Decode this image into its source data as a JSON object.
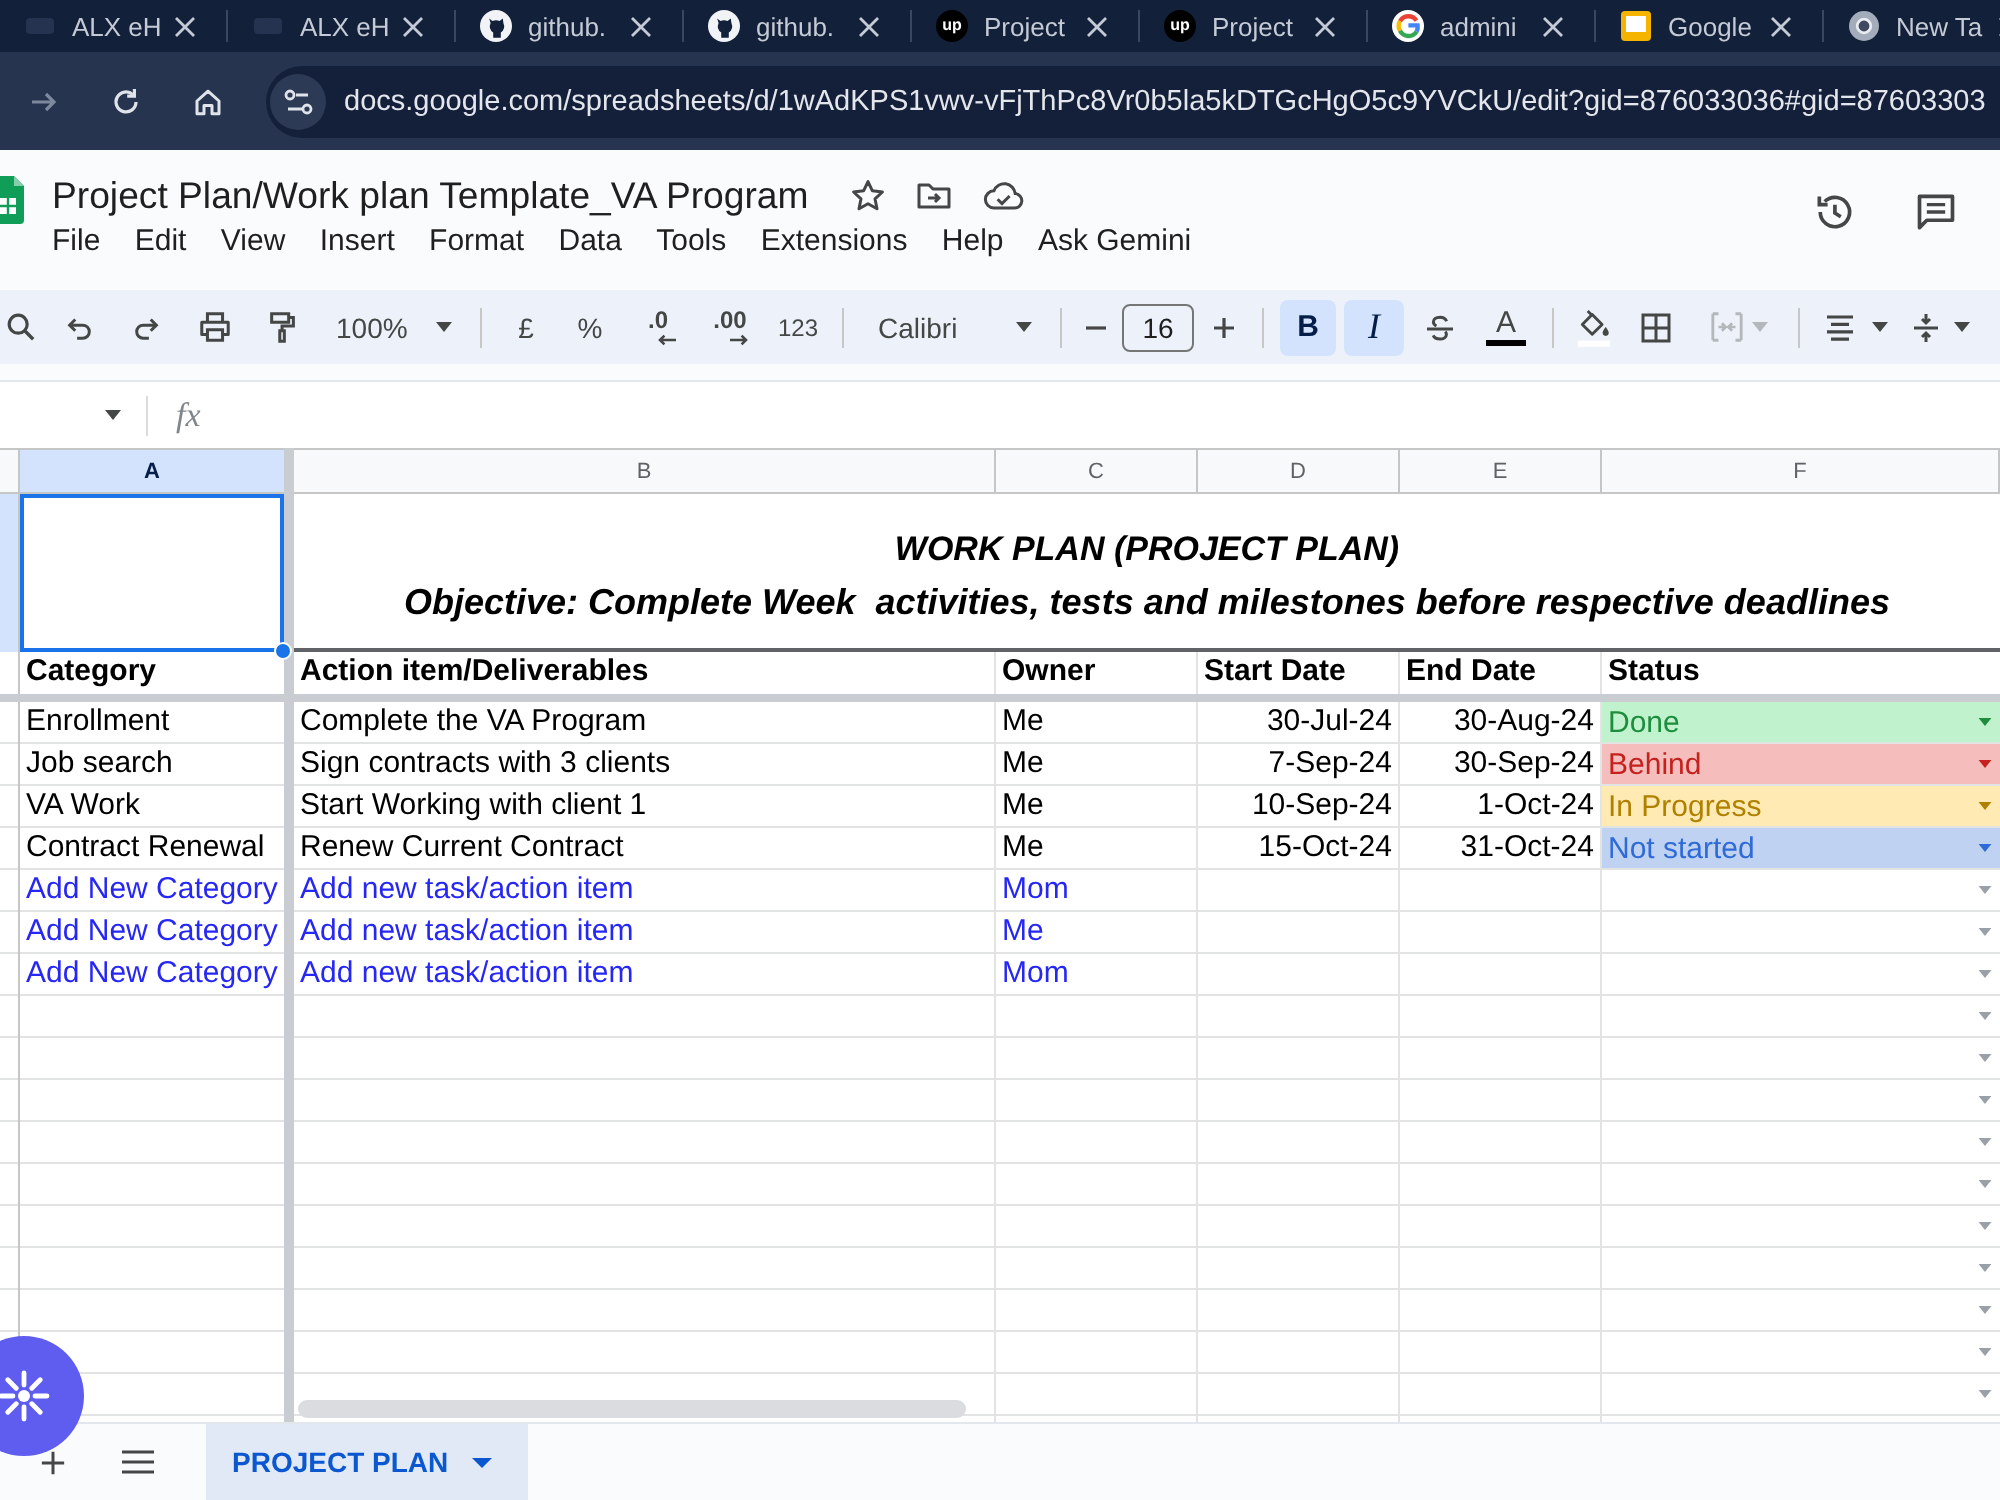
{
  "browser": {
    "tabs": [
      {
        "title": "ALX eH"
      },
      {
        "title": "ALX eH"
      },
      {
        "title": "github."
      },
      {
        "title": "github."
      },
      {
        "title": "Project",
        "badge": "up"
      },
      {
        "title": "Project",
        "badge": "up"
      },
      {
        "title": "admini"
      },
      {
        "title": "Google"
      },
      {
        "title": "New Ta"
      }
    ],
    "url": "docs.google.com/spreadsheets/d/1wAdKPS1vwv-vFjThPc8Vr0b5la5kDTGcHgO5c9YVCkU/edit?gid=876033036#gid=87603303"
  },
  "document": {
    "title": "Project Plan/Work plan Template_VA Program",
    "menu": [
      "File",
      "Edit",
      "View",
      "Insert",
      "Format",
      "Data",
      "Tools",
      "Extensions",
      "Help",
      "Ask Gemini"
    ]
  },
  "toolbar": {
    "zoom": "100%",
    "currency": "£",
    "percent": "%",
    "decrease_decimals": ".0",
    "increase_decimals": ".00",
    "number_format": "123",
    "font": "Calibri",
    "font_size": "16",
    "bold": {
      "label": "B",
      "on": true
    },
    "italic": {
      "label": "I",
      "on": true
    },
    "text_color": "A",
    "merge": {
      "disabled": true
    }
  },
  "formula_bar": {
    "label": "fx"
  },
  "sheet": {
    "columns": [
      {
        "label": "A",
        "selected": true
      },
      {
        "label": "B",
        "selected": false
      },
      {
        "label": "C",
        "selected": false
      },
      {
        "label": "D",
        "selected": false
      },
      {
        "label": "E",
        "selected": false
      },
      {
        "label": "F",
        "selected": false
      }
    ],
    "first_cell": {
      "selected": true
    },
    "title": "WORK PLAN (PROJECT PLAN)",
    "objective": "Objective: Complete Week  activities, tests and milestones before respective deadlines",
    "headers": [
      "Category",
      "Action item/Deliverables",
      "Owner",
      "Start Date",
      "End Date",
      "Status"
    ],
    "rows": [
      {
        "kind": "task",
        "category": "Enrollment",
        "action": "Complete the VA Program",
        "owner": "Me",
        "start": "30-Jul-24",
        "end": "30-Aug-24",
        "status": {
          "text": "Done",
          "color": "#1e8e3e"
        }
      },
      {
        "kind": "task",
        "category": "Job search",
        "action": "Sign contracts with 3 clients",
        "owner": "Me",
        "start": "7-Sep-24",
        "end": "30-Sep-24",
        "status": {
          "text": "Behind",
          "color": "#c5221f"
        }
      },
      {
        "kind": "task",
        "category": "VA Work",
        "action": "Start Working with client 1",
        "owner": "Me",
        "start": "10-Sep-24",
        "end": "1-Oct-24",
        "status": {
          "text": "In Progress",
          "color": "#b08000"
        }
      },
      {
        "kind": "task",
        "category": "Contract Renewal",
        "action": "Renew Current Contract",
        "owner": "Me",
        "start": "15-Oct-24",
        "end": "31-Oct-24",
        "status": {
          "text": "Not started",
          "color": "#2f6bd6"
        }
      },
      {
        "kind": "template",
        "category": "Add New Category",
        "action": "Add new task/action item",
        "owner": "Mom"
      },
      {
        "kind": "template",
        "category": "Add New Category",
        "action": "Add new task/action item",
        "owner": "Me"
      },
      {
        "kind": "template",
        "category": "Add New Category",
        "action": "Add new task/action item",
        "owner": "Mom"
      }
    ]
  },
  "sheet_tabs": [
    {
      "label": "PROJECT PLAN",
      "selected": true
    }
  ]
}
